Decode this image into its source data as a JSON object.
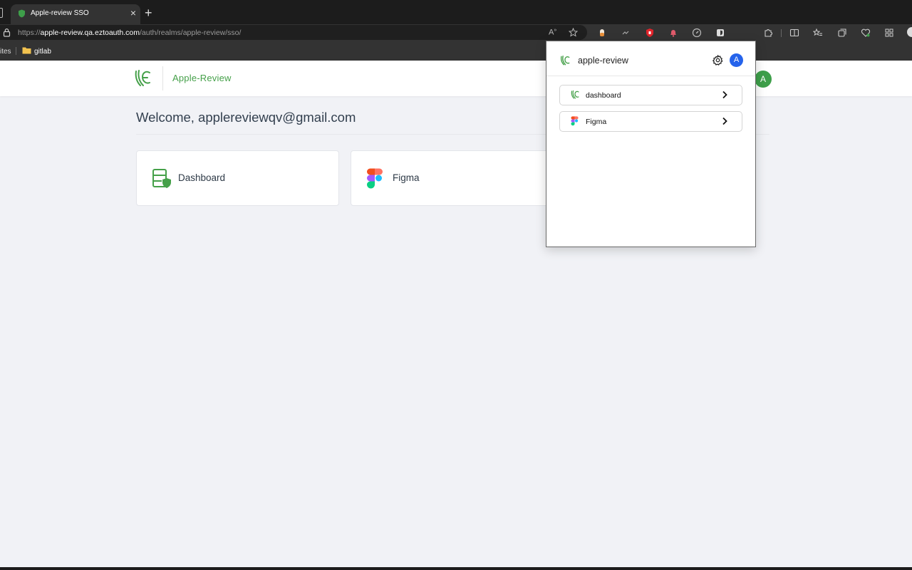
{
  "browser": {
    "tab_title": "Apple-review SSO",
    "tab_close": "×",
    "new_tab": "+",
    "url_prefix": "https://",
    "url_host": "apple-review.qa.eztoauth.com",
    "url_path": "/auth/realms/apple-review/sso/",
    "bookmarks": {
      "sites_label": "ites",
      "folder_label": "gitlab"
    }
  },
  "page": {
    "brand": "Apple-Review",
    "avatar_initial": "A",
    "welcome": "Welcome, applereviewqv@gmail.com",
    "apps": [
      {
        "label": "Dashboard",
        "icon": "dashboard-shield-icon"
      },
      {
        "label": "Figma",
        "icon": "figma-icon"
      }
    ]
  },
  "popup": {
    "title": "apple-review",
    "avatar_initial": "A",
    "items": [
      {
        "label": "dashboard",
        "icon": "eztoauth-logo-icon"
      },
      {
        "label": "Figma",
        "icon": "figma-icon"
      }
    ]
  },
  "colors": {
    "brand_green": "#45a049",
    "avatar_green": "#3e9f4a",
    "popup_avatar_blue": "#2563eb"
  }
}
